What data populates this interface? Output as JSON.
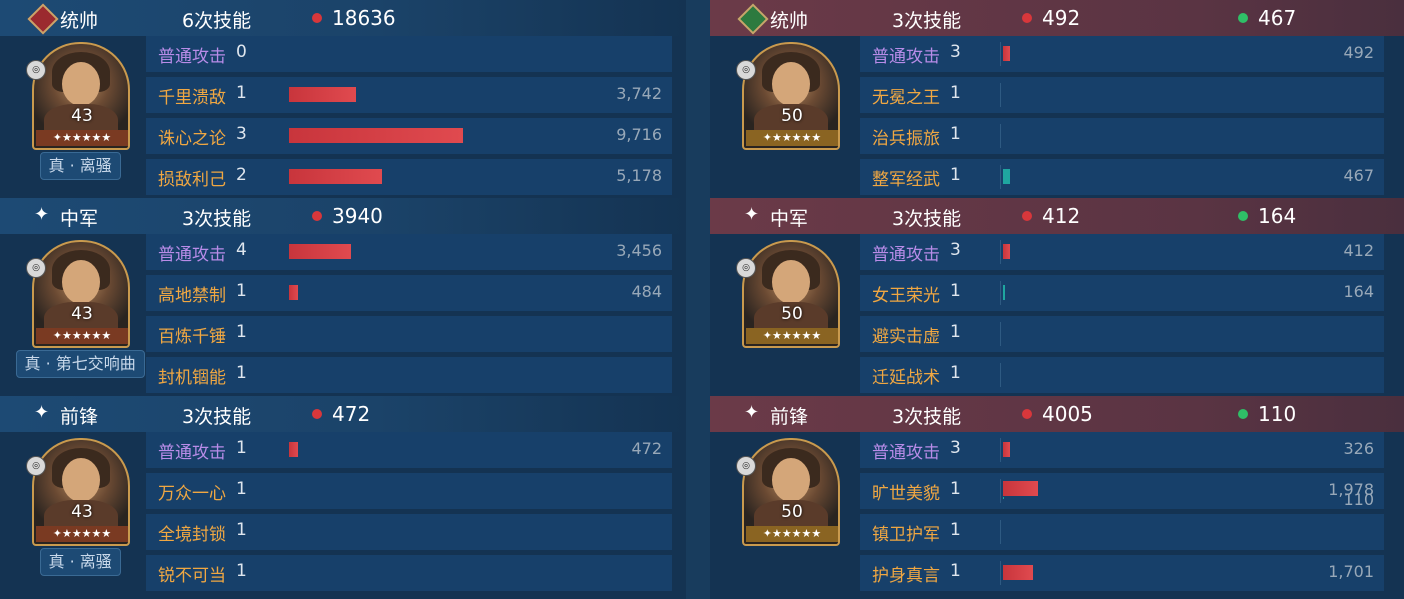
{
  "left": {
    "units": [
      {
        "role": "统帅",
        "role_icon": "sword-diamond-icon",
        "skill_count": "6次技能",
        "damage": "18636",
        "heal": "",
        "level": "43",
        "stars": "✦★★★★★",
        "title": "真 · 离骚",
        "skills": [
          {
            "name": "普通攻击",
            "level": "0",
            "basic": true,
            "dmg": "",
            "dmg_frac": 0,
            "heal": "",
            "heal_frac": 0
          },
          {
            "name": "千里溃敌",
            "level": "1",
            "basic": false,
            "dmg": "3,742",
            "dmg_frac": 0.385,
            "heal": "",
            "heal_frac": 0
          },
          {
            "name": "诛心之论",
            "level": "3",
            "basic": false,
            "dmg": "9,716",
            "dmg_frac": 1.0,
            "heal": "",
            "heal_frac": 0
          },
          {
            "name": "损敌利己",
            "level": "2",
            "basic": false,
            "dmg": "5,178",
            "dmg_frac": 0.533,
            "heal": "",
            "heal_frac": 0
          }
        ]
      },
      {
        "role": "中军",
        "role_icon": "star-icon",
        "skill_count": "3次技能",
        "damage": "3940",
        "heal": "",
        "level": "43",
        "stars": "✦★★★★★",
        "title": "真 · 第七交响曲",
        "skills": [
          {
            "name": "普通攻击",
            "level": "4",
            "basic": true,
            "dmg": "3,456",
            "dmg_frac": 0.356,
            "heal": "",
            "heal_frac": 0
          },
          {
            "name": "高地禁制",
            "level": "1",
            "basic": false,
            "dmg": "484",
            "dmg_frac": 0.05,
            "heal": "",
            "heal_frac": 0
          },
          {
            "name": "百炼千锤",
            "level": "1",
            "basic": false,
            "dmg": "",
            "dmg_frac": 0,
            "heal": "",
            "heal_frac": 0
          },
          {
            "name": "封机锢能",
            "level": "1",
            "basic": false,
            "dmg": "",
            "dmg_frac": 0,
            "heal": "",
            "heal_frac": 0
          }
        ]
      },
      {
        "role": "前锋",
        "role_icon": "star-icon",
        "skill_count": "3次技能",
        "damage": "472",
        "heal": "",
        "level": "43",
        "stars": "✦★★★★★",
        "title": "真 · 离骚",
        "skills": [
          {
            "name": "普通攻击",
            "level": "1",
            "basic": true,
            "dmg": "472",
            "dmg_frac": 0.05,
            "heal": "",
            "heal_frac": 0
          },
          {
            "name": "万众一心",
            "level": "1",
            "basic": false,
            "dmg": "",
            "dmg_frac": 0,
            "heal": "",
            "heal_frac": 0
          },
          {
            "name": "全境封锁",
            "level": "1",
            "basic": false,
            "dmg": "",
            "dmg_frac": 0,
            "heal": "",
            "heal_frac": 0
          },
          {
            "name": "锐不可当",
            "level": "1",
            "basic": false,
            "dmg": "",
            "dmg_frac": 0,
            "heal": "",
            "heal_frac": 0
          }
        ]
      }
    ]
  },
  "right": {
    "units": [
      {
        "role": "统帅",
        "role_icon": "heart-diamond-icon",
        "skill_count": "3次技能",
        "damage": "492",
        "heal": "467",
        "level": "50",
        "stars": "✦★★★★★",
        "title": "",
        "skills": [
          {
            "name": "普通攻击",
            "level": "3",
            "basic": true,
            "dmg": "492",
            "dmg_frac": 0.04,
            "heal": "",
            "heal_frac": 0
          },
          {
            "name": "无冕之王",
            "level": "1",
            "basic": false,
            "dmg": "",
            "dmg_frac": 0,
            "heal": "",
            "heal_frac": 0
          },
          {
            "name": "治兵振旅",
            "level": "1",
            "basic": false,
            "dmg": "",
            "dmg_frac": 0,
            "heal": "",
            "heal_frac": 0
          },
          {
            "name": "整军经武",
            "level": "1",
            "basic": false,
            "dmg": "",
            "dmg_frac": 0,
            "heal": "467",
            "heal_frac": 0.04
          }
        ]
      },
      {
        "role": "中军",
        "role_icon": "star-icon",
        "skill_count": "3次技能",
        "damage": "412",
        "heal": "164",
        "level": "50",
        "stars": "✦★★★★★",
        "title": "",
        "skills": [
          {
            "name": "普通攻击",
            "level": "3",
            "basic": true,
            "dmg": "412",
            "dmg_frac": 0.04,
            "heal": "",
            "heal_frac": 0
          },
          {
            "name": "女王荣光",
            "level": "1",
            "basic": false,
            "dmg": "",
            "dmg_frac": 0,
            "heal": "164",
            "heal_frac": 0.01
          },
          {
            "name": "避实击虚",
            "level": "1",
            "basic": false,
            "dmg": "",
            "dmg_frac": 0,
            "heal": "",
            "heal_frac": 0
          },
          {
            "name": "迁延战术",
            "level": "1",
            "basic": false,
            "dmg": "",
            "dmg_frac": 0,
            "heal": "",
            "heal_frac": 0
          }
        ]
      },
      {
        "role": "前锋",
        "role_icon": "star-icon",
        "skill_count": "3次技能",
        "damage": "4005",
        "heal": "110",
        "level": "50",
        "stars": "✦★★★★★",
        "title": "",
        "skills": [
          {
            "name": "普通攻击",
            "level": "3",
            "basic": true,
            "dmg": "326",
            "dmg_frac": 0.03,
            "heal": "",
            "heal_frac": 0
          },
          {
            "name": "旷世美貌",
            "level": "1",
            "basic": false,
            "dmg": "1,978",
            "dmg_frac": 0.2,
            "heal": "110",
            "heal_frac": 0.005
          },
          {
            "name": "镇卫护军",
            "level": "1",
            "basic": false,
            "dmg": "",
            "dmg_frac": 0,
            "heal": "",
            "heal_frac": 0
          },
          {
            "name": "护身真言",
            "level": "1",
            "basic": false,
            "dmg": "1,701",
            "dmg_frac": 0.175,
            "heal": "",
            "heal_frac": 0
          }
        ]
      }
    ]
  },
  "colors": {
    "damage": "#d8373b",
    "heal": "#2fbf67",
    "basic_skill": "#b88ce8",
    "skill": "#f0a742"
  }
}
